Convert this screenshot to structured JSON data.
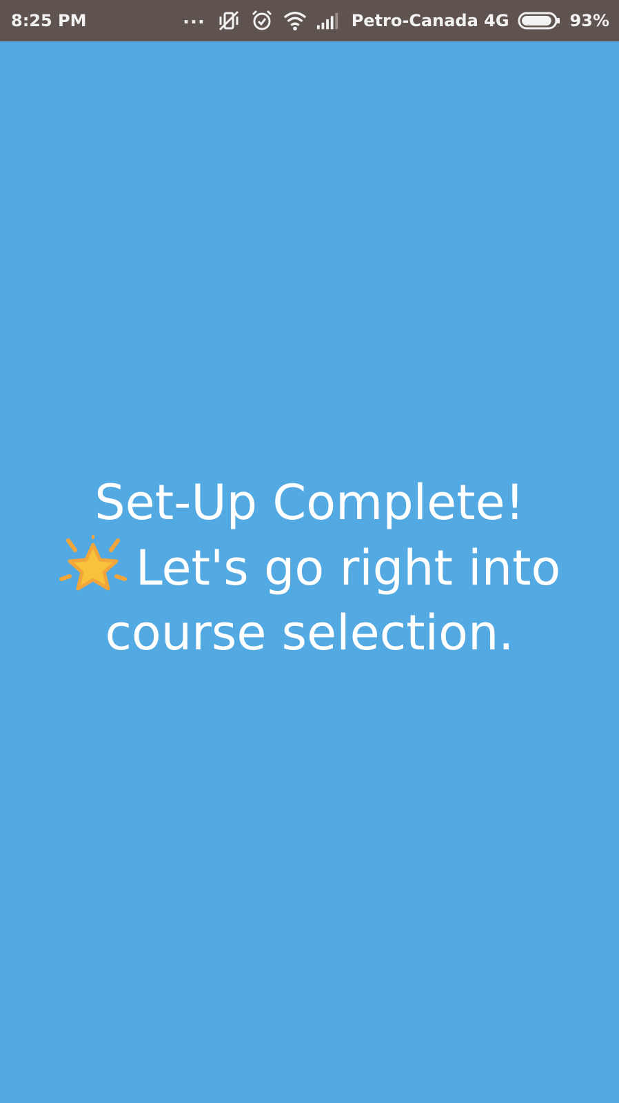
{
  "status_bar": {
    "time": "8:25 PM",
    "dots": "...",
    "carrier": "Petro-Canada 4G",
    "battery_percent": "93%",
    "battery_level": 0.93,
    "icons": [
      "vibrate-off-icon",
      "alarm-icon",
      "wifi-icon",
      "signal-icon",
      "battery-icon"
    ]
  },
  "screen": {
    "background_color": "#53a9e1",
    "message": {
      "line1": "Set-Up Complete!",
      "emoji_icon": "sparkle-star-icon",
      "line2": "Let's go right into",
      "line3": "course selection."
    }
  }
}
